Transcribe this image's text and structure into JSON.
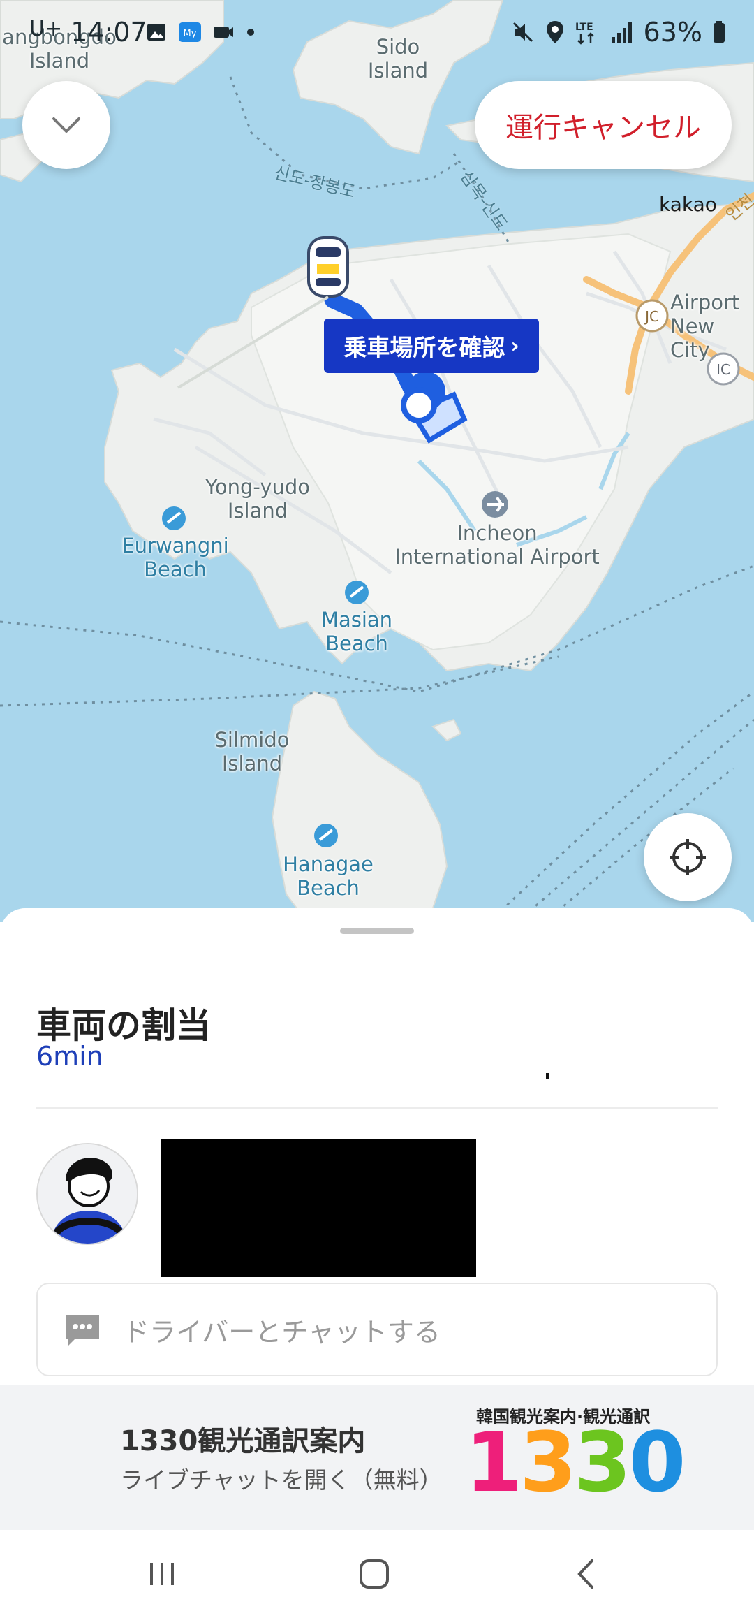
{
  "status_bar": {
    "time": "14:07",
    "carrier": "U+",
    "battery": "63%",
    "network": "LTE",
    "icons": [
      "gallery-icon",
      "my-app-icon",
      "video-icon",
      "dot-icon",
      "mute-icon",
      "location-icon",
      "lte-icon",
      "signal-icon",
      "battery-icon"
    ]
  },
  "map": {
    "attribution": "kakao",
    "labels": {
      "sido_island": "Sido\nIsland",
      "sindo_island_partial": "angbongdo\nIsland",
      "sido_jangbongdo_route": "신도-장봉도",
      "sammok_sindo_route": "삼목-신도",
      "incheon_road": "인천",
      "airport_new_city": "Airport\nNew City",
      "yong_yudo_island": "Yong-yudo\nIsland",
      "eurwangni_beach": "Eurwangni\nBeach",
      "incheon_airport": "Incheon\nInternational Airport",
      "masian_beach": "Masian\nBeach",
      "silmido_island": "Silmido\nIsland",
      "hanagae_beach": "Hanagae\nBeach",
      "jc": "JC",
      "ic": "IC"
    },
    "pickup_tag": "乗車場所を確認",
    "accent": "#1637c4",
    "route_color": "#1f5fe0"
  },
  "buttons": {
    "cancel": "運行キャンセル",
    "collapse_icon": "chevron-down-icon",
    "locate_icon": "crosshair-icon"
  },
  "sheet": {
    "title": "車両の割当",
    "eta": "6min",
    "chat_placeholder": "ドライバーとチャットする"
  },
  "banner": {
    "title": "1330観光通訳案内",
    "subtitle": "ライブチャットを開く（無料）",
    "caption": "韓国観光案内·観光通訳",
    "logo_digits": [
      "1",
      "3",
      "3",
      "0"
    ],
    "logo_colors": [
      "#ee1f7a",
      "#ff9e1b",
      "#6cc51f",
      "#1e8fe0"
    ]
  },
  "navbar": {
    "recents_icon": "recents-icon",
    "home_icon": "home-icon",
    "back_icon": "back-icon"
  }
}
